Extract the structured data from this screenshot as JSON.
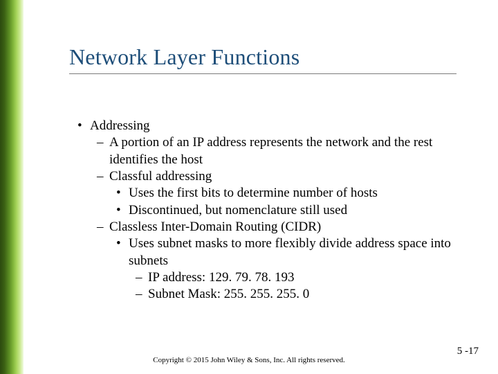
{
  "title": "Network Layer Functions",
  "bullets": {
    "b0": "Addressing",
    "b1": "A portion of an IP address represents the network and the rest identifies the host",
    "b2": "Classful addressing",
    "b2a": "Uses the first bits to determine number of hosts",
    "b2b": "Discontinued, but nomenclature still used",
    "b3": "Classless Inter-Domain Routing (CIDR)",
    "b3a": "Uses subnet masks to more flexibly divide address space into subnets",
    "b3b": "IP address: 129. 79. 78. 193",
    "b3c": "Subnet Mask: 255. 255. 255. 0"
  },
  "footer": "Copyright © 2015 John Wiley & Sons, Inc. All rights reserved.",
  "page": "5 -17"
}
